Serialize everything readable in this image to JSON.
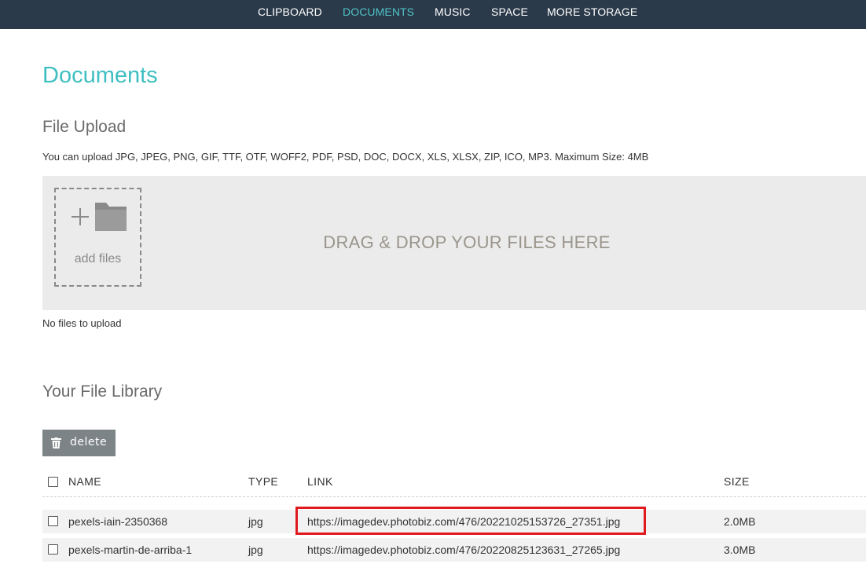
{
  "nav": {
    "items": [
      "CLIPBOARD",
      "DOCUMENTS",
      "MUSIC",
      "SPACE",
      "MORE STORAGE"
    ],
    "active": "DOCUMENTS",
    "active_color": "#4fc3c6",
    "bg_color": "#2b3a4a"
  },
  "page": {
    "title": "Documents",
    "title_color": "#3fbfc2"
  },
  "upload": {
    "section_title": "File Upload",
    "info": "You can upload JPG, JPEG, PNG, GIF, TTF, OTF, WOFF2, PDF, PSD, DOC, DOCX, XLS, XLSX, ZIP, ICO, MP3. Maximum Size: 4MB",
    "add_files_label": "add files",
    "drop_text": "DRAG & DROP YOUR FILES HERE",
    "status": "No files to upload",
    "icons": [
      "plus-icon",
      "folder-icon"
    ]
  },
  "library": {
    "section_title": "Your File Library",
    "delete_label": "delete",
    "delete_icon": "trash-icon",
    "columns": {
      "name": "NAME",
      "type": "TYPE",
      "link": "LINK",
      "size": "SIZE"
    },
    "rows": [
      {
        "name": "pexels-iain-2350368",
        "type": "jpg",
        "link": "https://imagedev.photobiz.com/476/20221025153726_27351.jpg",
        "size": "2.0MB",
        "highlighted": true
      },
      {
        "name": "pexels-martin-de-arriba-1",
        "type": "jpg",
        "link": "https://imagedev.photobiz.com/476/20220825123631_27265.jpg",
        "size": "3.0MB",
        "highlighted": false
      }
    ],
    "highlight_color": "#e0191f"
  }
}
